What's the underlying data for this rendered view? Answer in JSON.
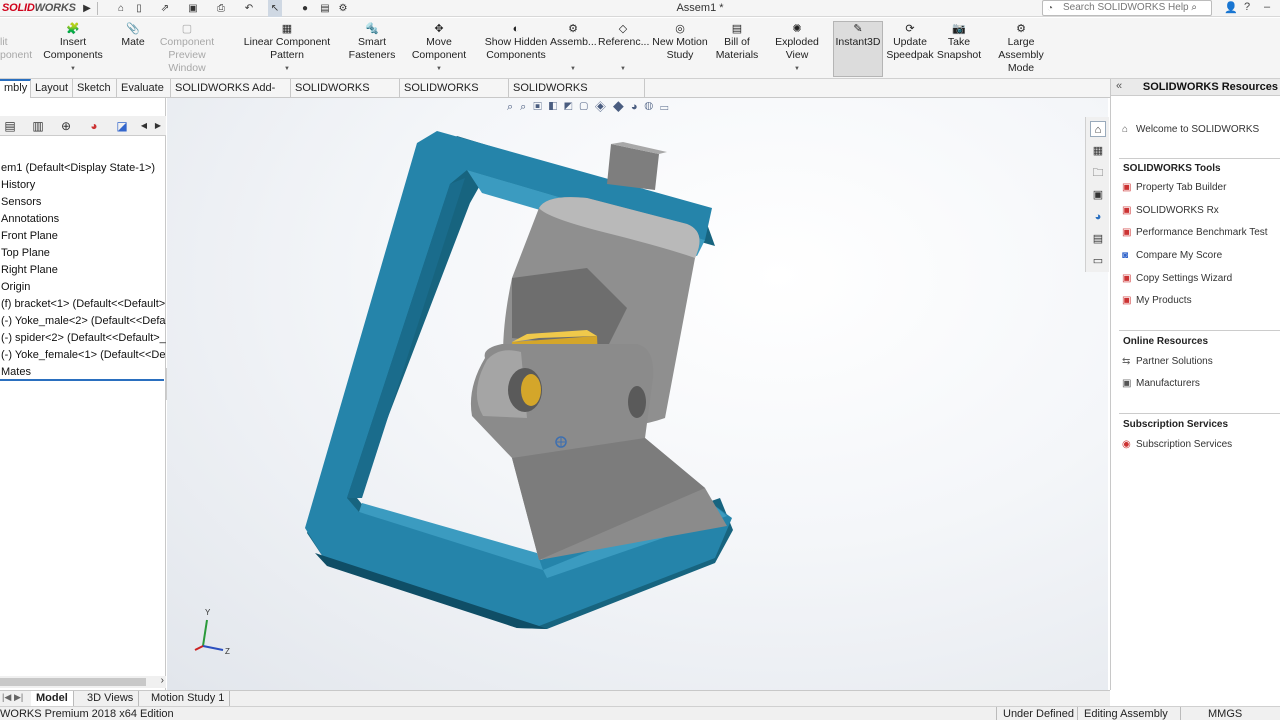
{
  "app": {
    "logo_ds": "DS",
    "logo_solid": "SOLID",
    "logo_works": "WORKS",
    "doc_title": "Assem1 *",
    "search_placeholder": "Search SOLIDWORKS Help"
  },
  "commands": [
    {
      "label": "lit",
      "label2": "ponent",
      "state": "disabled"
    },
    {
      "label": "Insert Components",
      "label2": "",
      "state": "normal"
    },
    {
      "label": "Mate",
      "label2": "",
      "state": "normal"
    },
    {
      "label": "Component",
      "label2": "Preview Window",
      "state": "disabled"
    },
    {
      "label": "Linear Component Pattern",
      "label2": "",
      "state": "normal"
    },
    {
      "label": "Smart",
      "label2": "Fasteners",
      "state": "normal"
    },
    {
      "label": "Move Component",
      "label2": "",
      "state": "normal"
    },
    {
      "label": "Show Hidden",
      "label2": "Components",
      "state": "normal"
    },
    {
      "label": "Assemb...",
      "label2": "",
      "state": "normal"
    },
    {
      "label": "Referenc...",
      "label2": "",
      "state": "normal"
    },
    {
      "label": "New Motion",
      "label2": "Study",
      "state": "normal"
    },
    {
      "label": "Bill of",
      "label2": "Materials",
      "state": "normal"
    },
    {
      "label": "Exploded View",
      "label2": "",
      "state": "normal"
    },
    {
      "label": "Instant3D",
      "label2": "",
      "state": "active"
    },
    {
      "label": "Update",
      "label2": "Speedpak",
      "state": "normal"
    },
    {
      "label": "Take",
      "label2": "Snapshot",
      "state": "normal"
    },
    {
      "label": "Large Assembly",
      "label2": "Mode",
      "state": "normal"
    }
  ],
  "tabs": [
    "mbly",
    "Layout",
    "Sketch",
    "Evaluate",
    "SOLIDWORKS Add-Ins",
    "SOLIDWORKS MBD",
    "SOLIDWORKS CAM",
    "SOLIDWORKS Inspection"
  ],
  "active_tab": "mbly",
  "feature_tree": [
    "em1  (Default<Display State-1>)",
    "History",
    "Sensors",
    "Annotations",
    "Front Plane",
    "Top Plane",
    "Right Plane",
    "Origin",
    "(f) bracket<1> (Default<<Default>",
    "(-) Yoke_male<2> (Default<<Defa",
    "(-) spider<2> (Default<<Default>_",
    "(-) Yoke_female<1> (Default<<De",
    "Mates"
  ],
  "axes": {
    "y": "Y",
    "z": "Z"
  },
  "resources": {
    "title": "SOLIDWORKS Resources",
    "welcome": "Welcome to SOLIDWORKS",
    "tools_header": "SOLIDWORKS Tools",
    "tools": [
      "Property Tab Builder",
      "SOLIDWORKS Rx",
      "Performance Benchmark Test",
      "Compare My Score",
      "Copy Settings Wizard",
      "My Products"
    ],
    "online_header": "Online Resources",
    "online": [
      "Partner Solutions",
      "Manufacturers"
    ],
    "subscription_header": "Subscription Services",
    "subscription": [
      "Subscription Services"
    ]
  },
  "bottom_tabs": [
    "Model",
    "3D Views",
    "Motion Study 1"
  ],
  "active_bottom_tab": "Model",
  "status": {
    "edition": "WORKS Premium 2018 x64 Edition",
    "defined": "Under Defined",
    "mode": "Editing Assembly",
    "units": "MMGS"
  },
  "colors": {
    "bracket": "#1f7fa6",
    "steel": "#8c8c8c",
    "spider": "#d4a62a",
    "accent": "#2a6fbf",
    "brand_red": "#d0021b"
  }
}
